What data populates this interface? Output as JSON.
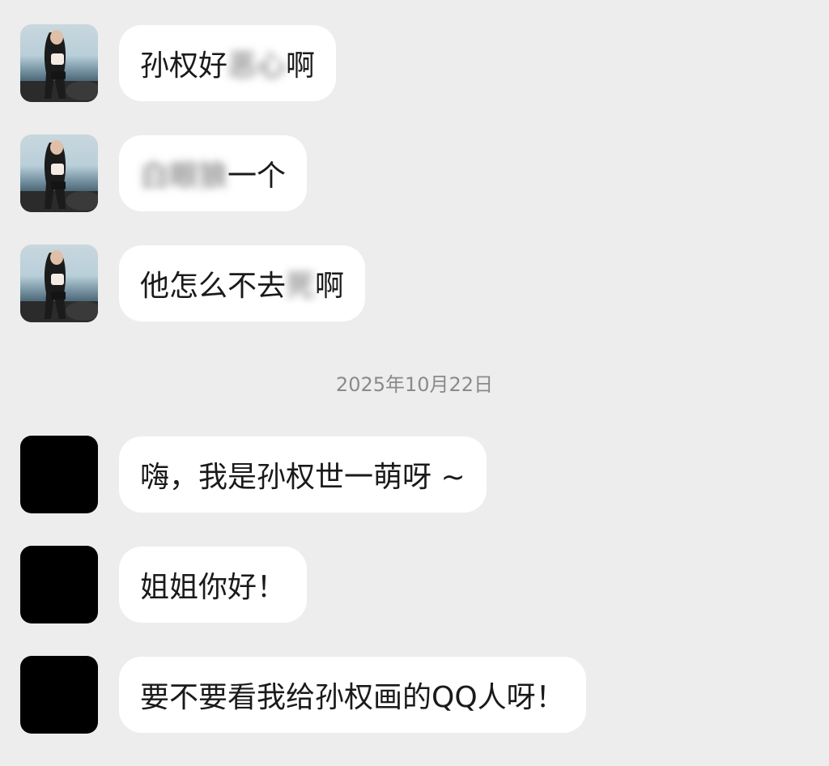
{
  "messages_before": [
    {
      "parts": [
        {
          "text": "孙权好",
          "blurred": false
        },
        {
          "text": "恶心",
          "blurred": true
        },
        {
          "text": "啊",
          "blurred": false
        }
      ]
    },
    {
      "parts": [
        {
          "text": "白眼狼",
          "blurred": true
        },
        {
          "text": "一个",
          "blurred": false
        }
      ]
    },
    {
      "parts": [
        {
          "text": "他怎么不去",
          "blurred": false
        },
        {
          "text": "死",
          "blurred": true
        },
        {
          "text": "啊",
          "blurred": false
        }
      ]
    }
  ],
  "timestamp": "2025年10月22日",
  "messages_after": [
    {
      "text": "嗨，我是孙权世一萌呀 ~"
    },
    {
      "text": "姐姐你好！"
    },
    {
      "text": "要不要看我给孙权画的QQ人呀！"
    }
  ],
  "colors": {
    "background": "#ededee",
    "bubble": "#ffffff",
    "text": "#1a1a1a",
    "timestamp": "#8a8a8a"
  }
}
